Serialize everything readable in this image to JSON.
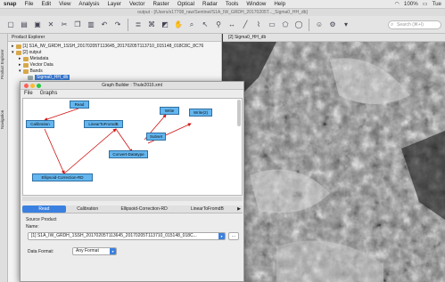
{
  "menubar": {
    "app": "snap",
    "items": [
      "File",
      "Edit",
      "View",
      "Analysis",
      "Layer",
      "Vector",
      "Raster",
      "Optical",
      "Radar",
      "Tools",
      "Window",
      "Help"
    ],
    "battery": "100%",
    "day": "Tue"
  },
  "window_title": "output - [/Users/s17708_raw/Sentinel/S1A_IW_GRDH_20170205T..._Sigma0_HH_db]",
  "search": {
    "placeholder": "Search (⌘+I)"
  },
  "left_tabs": [
    "Product Explorer",
    "Navigation"
  ],
  "explorer": {
    "title": "Product Explorer",
    "items": [
      {
        "label": "[1] S1A_IW_GRDH_1SSH_20170205T113645_20170205T113710_015148_018C8C_8C76"
      },
      {
        "label": "[2] output"
      },
      {
        "label": "Metadata"
      },
      {
        "label": "Vector Data"
      },
      {
        "label": "Bands"
      },
      {
        "label": "Sigma0_HH_db"
      }
    ]
  },
  "image_tab": "[2] Sigma0_HH_db",
  "graph_builder": {
    "title": "Graph Builder : Thule2016.xml",
    "menu": [
      "File",
      "Graphs"
    ],
    "nodes": [
      "Read",
      "Calibration",
      "LinearToFromdB",
      "Write",
      "Write(2)",
      "Subset",
      "Ellipsoid-Correction-RD",
      "Convert-Datatype"
    ],
    "tabs": [
      "Read",
      "Calibration",
      "Ellipsoid-Correction-RD",
      "LinearToFromdB"
    ],
    "source_label": "Source Product",
    "name_label": "Name:",
    "name_value": "[1] S1A_IW_GRDH_1SSH_20170205T113645_20170205T113710_015148_018C...",
    "format_label": "Data Format:",
    "format_value": "Any Format",
    "browse_label": "..."
  }
}
